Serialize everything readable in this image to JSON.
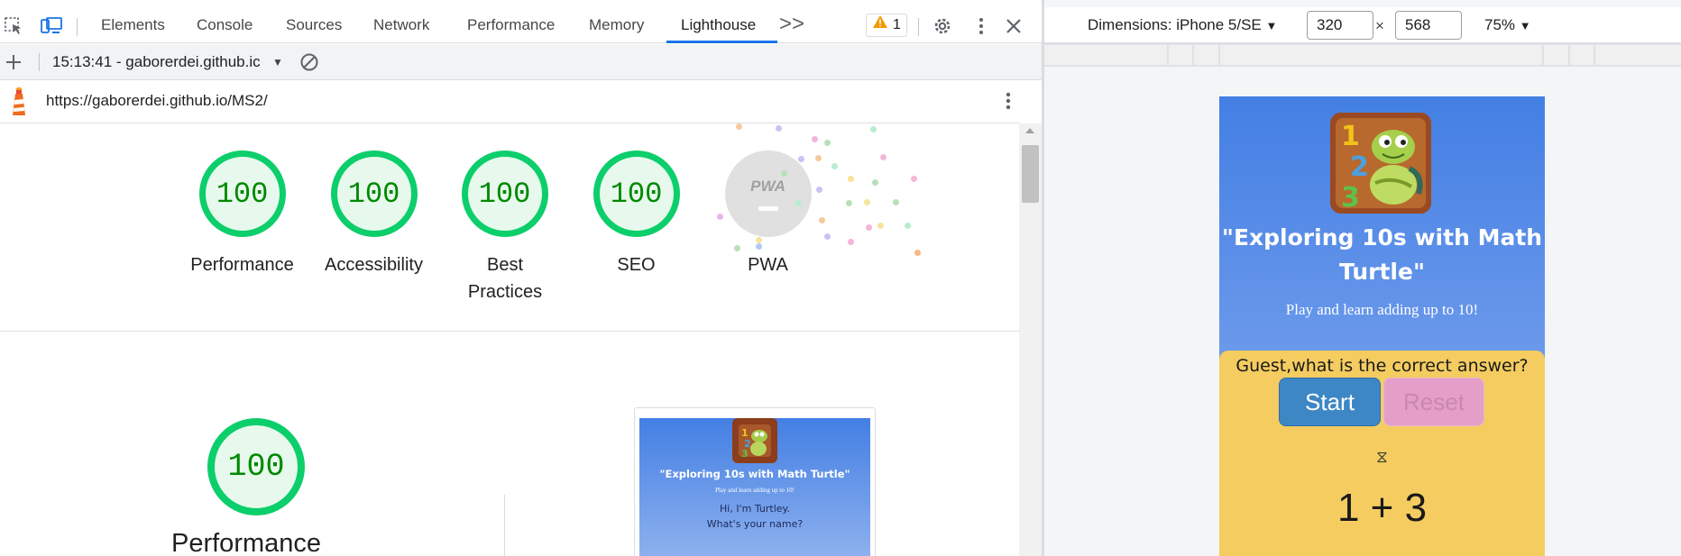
{
  "devtools": {
    "tabs": [
      {
        "label": "Elements"
      },
      {
        "label": "Console"
      },
      {
        "label": "Sources"
      },
      {
        "label": "Network"
      },
      {
        "label": "Performance"
      },
      {
        "label": "Memory"
      },
      {
        "label": "Lighthouse"
      }
    ],
    "active_tab": "Lighthouse",
    "more_tabs_glyph": ">>",
    "warning_count": "1",
    "report_select": "15:13:41 - gaborerdei.github.ic",
    "url": "https://gaborerdei.github.io/MS2/"
  },
  "lighthouse": {
    "categories": [
      {
        "label": "Performance",
        "score": "100"
      },
      {
        "label": "Accessibility",
        "score": "100"
      },
      {
        "label": "Best Practices",
        "score": "100"
      },
      {
        "label": "SEO",
        "score": "100"
      },
      {
        "label": "PWA",
        "score": "PWA"
      }
    ],
    "detail": {
      "score": "100",
      "title": "Performance"
    },
    "thumbnail": {
      "title": "\"Exploring 10s with Math Turtle\"",
      "tagline": "Play and learn adding up to 10!",
      "greeting_line1": "Hi, I'm Turtley.",
      "greeting_line2": "What's your name?"
    },
    "colors": {
      "pass_ring": "#0cce6b",
      "pass_fill": "#e6f9ec",
      "pass_text": "#008800"
    }
  },
  "device": {
    "dimensions_label": "Dimensions: iPhone 5/SE",
    "width": "320",
    "times": "×",
    "height": "568",
    "zoom": "75%"
  },
  "app": {
    "title": "\"Exploring 10s with Math Turtle\"",
    "tagline": "Play and learn adding up to 10!",
    "question": "Guest,what is the correct answer?",
    "start_label": "Start",
    "reset_label": "Reset",
    "timer_icon": "⧖",
    "equation": "1 + 3",
    "colors": {
      "bg_top": "#437fe4",
      "panel": "#f4cc60",
      "start": "#3d87c4",
      "reset": "#e49ec8"
    }
  }
}
